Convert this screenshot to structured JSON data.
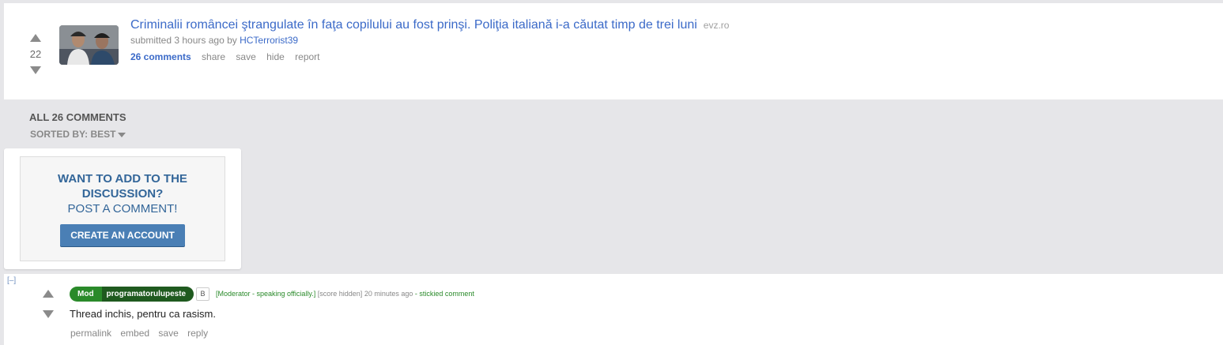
{
  "post": {
    "score": "22",
    "title": "Criminalii romȃncei ştrangulate în faţa copilului au fost prinşi. Poliţia italiană i-a căutat timp de trei luni",
    "domain": "evz.ro",
    "submitted_prefix": "submitted 3 hours ago by",
    "author": "HCTerrorist39",
    "buttons": {
      "comments": "26 comments",
      "share": "share",
      "save": "save",
      "hide": "hide",
      "report": "report"
    }
  },
  "comments_header": {
    "title": "ALL 26 COMMENTS",
    "sorted_by": "SORTED BY: BEST"
  },
  "signup": {
    "question": "WANT TO ADD TO THE DISCUSSION?",
    "prompt": "POST A COMMENT!",
    "button": "CREATE AN ACCOUNT"
  },
  "comment": {
    "collapse": "[–]",
    "mod_label": "Mod",
    "author": "programatorulupeste",
    "badge": "B",
    "meta_distinguish": "[Moderator - speaking officially.]",
    "meta_score": "[score hidden]",
    "meta_time": "20 minutes ago",
    "meta_sticky": "- stickied comment",
    "body": "Thread inchis, pentru ca rasism.",
    "buttons": {
      "permalink": "permalink",
      "embed": "embed",
      "save": "save",
      "reply": "reply"
    }
  },
  "colors": {
    "link": "#3b6ac8",
    "mod_green": "#2a8a2a",
    "button_blue": "#4a7fb5"
  }
}
